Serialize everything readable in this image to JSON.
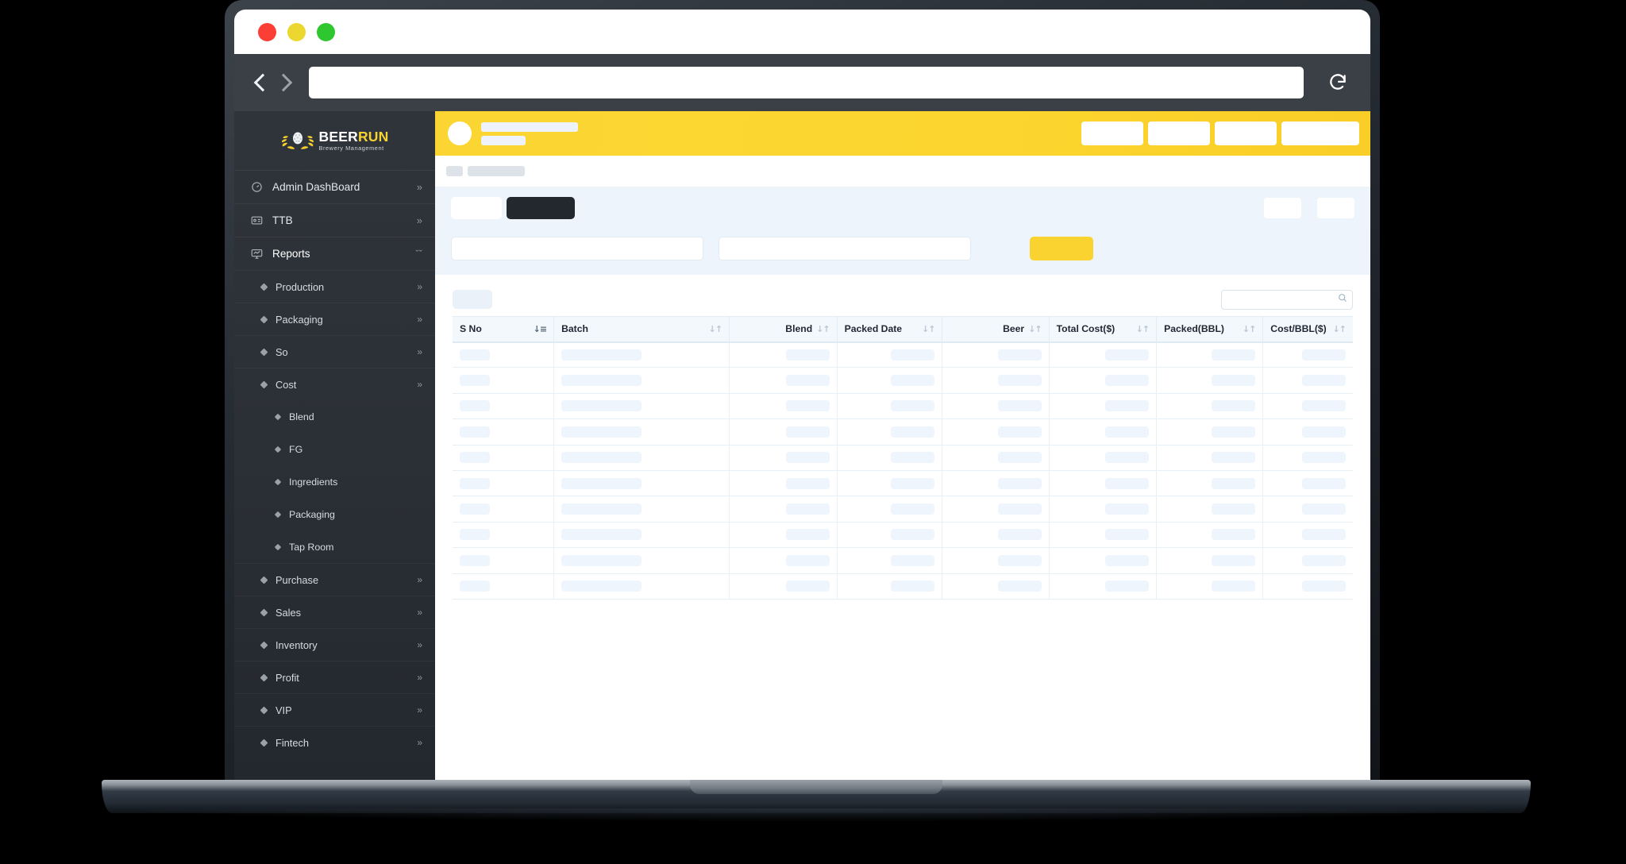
{
  "browser": {
    "url_value": "",
    "url_placeholder": "",
    "back_icon": "chevron-left-icon",
    "forward_icon": "chevron-right-icon",
    "reload_icon": "reload-icon",
    "traffic_lights": [
      "close",
      "minimize",
      "maximize"
    ]
  },
  "sidebar": {
    "logo": {
      "brand_first": "BEER",
      "brand_second": "RUN",
      "tagline": "Brewery Management"
    },
    "items": [
      {
        "label": "Admin DashBoard",
        "icon": "dashboard-gauge-icon",
        "arrow": "»",
        "level": 1
      },
      {
        "label": "TTB",
        "icon": "id-card-icon",
        "arrow": "»",
        "level": 1
      },
      {
        "label": "Reports",
        "icon": "monitor-chart-icon",
        "arrow": "ˇˇ",
        "level": 1,
        "active": true
      },
      {
        "label": "Production",
        "arrow": "»",
        "level": 2
      },
      {
        "label": "Packaging",
        "arrow": "»",
        "level": 2
      },
      {
        "label": "So",
        "arrow": "»",
        "level": 2
      },
      {
        "label": "Cost",
        "arrow": "»",
        "level": 2
      },
      {
        "label": "Blend",
        "level": 3
      },
      {
        "label": "FG",
        "level": 3
      },
      {
        "label": "Ingredients",
        "level": 3
      },
      {
        "label": "Packaging",
        "level": 3
      },
      {
        "label": "Tap Room",
        "level": 3
      },
      {
        "label": "Purchase",
        "arrow": "»",
        "level": 2
      },
      {
        "label": "Sales",
        "arrow": "»",
        "level": 2
      },
      {
        "label": "Inventory",
        "arrow": "»",
        "level": 2
      },
      {
        "label": "Profit",
        "arrow": "»",
        "level": 2
      },
      {
        "label": "VIP",
        "arrow": "»",
        "level": 2
      },
      {
        "label": "Fintech",
        "arrow": "»",
        "level": 2
      }
    ]
  },
  "header": {
    "user_name": "",
    "user_role": "",
    "actions": [
      "",
      "",
      "",
      ""
    ]
  },
  "breadcrumb": {
    "chips": [
      "",
      ""
    ]
  },
  "filters": {
    "tabs": [
      "",
      ""
    ],
    "tools": [
      "",
      ""
    ],
    "input_1_value": "",
    "input_1_placeholder": "",
    "input_2_value": "",
    "input_2_placeholder": "",
    "submit_label": ""
  },
  "table": {
    "search_value": "",
    "search_placeholder": "",
    "search_icon": "search-icon",
    "columns": [
      {
        "label": "S No",
        "align": "left",
        "sort": "asc",
        "key": "c-sno"
      },
      {
        "label": "Batch",
        "align": "left",
        "sort": "both",
        "key": "c-batch"
      },
      {
        "label": "Blend",
        "align": "right",
        "sort": "both",
        "key": "c-blend"
      },
      {
        "label": "Packed Date",
        "align": "left",
        "sort": "both",
        "key": "c-date"
      },
      {
        "label": "Beer",
        "align": "right",
        "sort": "both",
        "key": "c-beer"
      },
      {
        "label": "Total Cost($)",
        "align": "left",
        "sort": "both",
        "key": "c-total"
      },
      {
        "label": "Packed(BBL)",
        "align": "left",
        "sort": "both",
        "key": "c-packed"
      },
      {
        "label": "Cost/BBL($)",
        "align": "left",
        "sort": "both",
        "key": "c-cost"
      }
    ],
    "row_count": 10,
    "loading": true
  },
  "colors": {
    "brand_yellow": "#fbd330",
    "sidebar_dark": "#2f343a",
    "filter_panel_blue": "#edf4fb",
    "table_header_blue": "#f3f8fd",
    "skeleton_blue": "#eef5fc",
    "tab_dark": "#23282f"
  }
}
